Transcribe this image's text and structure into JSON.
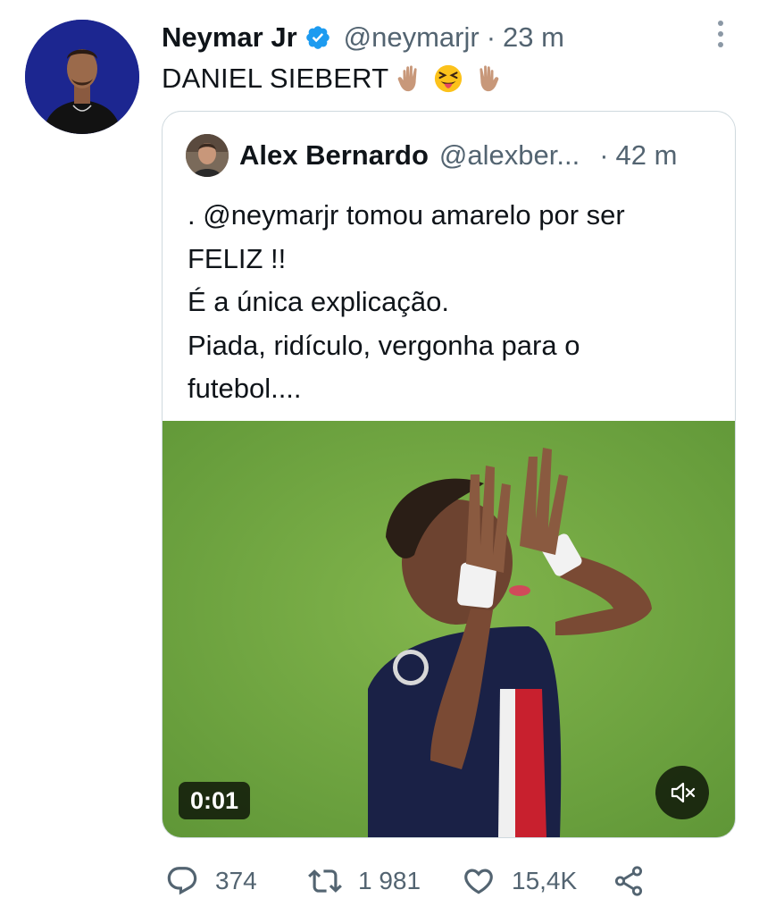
{
  "author": {
    "display_name": "Neymar Jr",
    "handle": "@neymarjr",
    "separator": "·",
    "time": "23 m",
    "text": "DANIEL SIEBERT",
    "emojis": [
      "raised-hand-icon",
      "squinting-tongue-face-icon",
      "raised-hand-icon"
    ]
  },
  "quote": {
    "display_name": "Alex Bernardo",
    "handle": "@alexber...",
    "separator": "·",
    "time": "42 m",
    "lines": [
      ". @neymarjr tomou amarelo por ser",
      "FELIZ !!",
      "É a única explicação.",
      "Piada, ridículo, vergonha para o",
      "futebol...."
    ],
    "media": {
      "duration": "0:01",
      "muted": true
    }
  },
  "actions": {
    "replies": "374",
    "retweets": "1 981",
    "likes": "15,4K"
  },
  "colors": {
    "text": "#0f1419",
    "secondary": "#536471",
    "verified": "#1d9bf0",
    "card_border": "#cfd9de",
    "pitch": "#74a843"
  }
}
